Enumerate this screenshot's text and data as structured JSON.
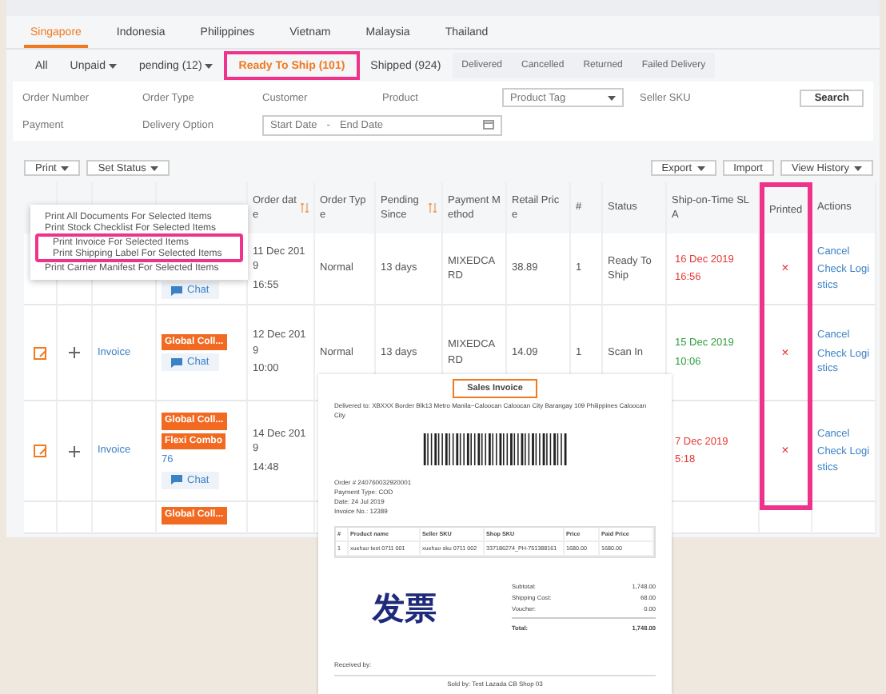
{
  "country_tabs": [
    {
      "label": "Singapore",
      "selected": true
    },
    {
      "label": "Indonesia",
      "selected": false
    },
    {
      "label": "Philippines",
      "selected": false
    },
    {
      "label": "Vietnam",
      "selected": false
    },
    {
      "label": "Malaysia",
      "selected": false
    },
    {
      "label": "Thailand",
      "selected": false
    }
  ],
  "status_tabs": [
    {
      "label": "All",
      "kind": "main",
      "dropdown": false,
      "selected": false,
      "highlighted": false
    },
    {
      "label": "Unpaid",
      "kind": "main",
      "dropdown": true,
      "selected": false,
      "highlighted": false
    },
    {
      "label": "pending (12)",
      "kind": "main",
      "dropdown": true,
      "selected": false,
      "highlighted": false
    },
    {
      "label": "Ready To Ship (101)",
      "kind": "main",
      "dropdown": false,
      "selected": true,
      "highlighted": true
    },
    {
      "label": "Shipped (924)",
      "kind": "main",
      "dropdown": false,
      "selected": false,
      "highlighted": false
    },
    {
      "label": "Delivered",
      "kind": "sub",
      "dropdown": false,
      "selected": false,
      "highlighted": false
    },
    {
      "label": "Cancelled",
      "kind": "sub",
      "dropdown": false,
      "selected": false,
      "highlighted": false
    },
    {
      "label": "Returned",
      "kind": "sub",
      "dropdown": false,
      "selected": false,
      "highlighted": false
    },
    {
      "label": "Failed Delivery",
      "kind": "sub",
      "dropdown": false,
      "selected": false,
      "highlighted": false
    }
  ],
  "filters": [
    [
      {
        "kind": "label",
        "text": "Order Number"
      },
      {
        "kind": "label",
        "text": "Order Type"
      },
      {
        "kind": "label",
        "text": "Customer"
      },
      {
        "kind": "label",
        "text": "Product"
      },
      {
        "kind": "select",
        "text": "Product Tag"
      },
      {
        "kind": "label",
        "text": "Seller SKU"
      },
      {
        "kind": "button",
        "text": "Search"
      }
    ],
    [
      {
        "kind": "label",
        "text": "Payment"
      },
      {
        "kind": "label",
        "text": "Delivery Option"
      },
      {
        "kind": "daterange",
        "start": "Start Date",
        "separator": "-",
        "end": "End Date"
      }
    ]
  ],
  "toolbar": {
    "left": [
      {
        "label": "Print",
        "dropdown": true
      },
      {
        "label": "Set Status",
        "dropdown": true
      }
    ],
    "right": [
      {
        "label": "Export",
        "dropdown": true
      },
      {
        "label": "Import",
        "dropdown": false
      },
      {
        "label": "View History",
        "dropdown": true
      }
    ]
  },
  "print_menu": [
    {
      "label": "Print All Documents For Selected Items",
      "highlighted": false
    },
    {
      "label": "Print Stock Checklist For Selected Items",
      "highlighted": false
    },
    {
      "label": "Print Invoice For Selected Items",
      "highlighted": true
    },
    {
      "label": "Print Shipping Label For Selected Items",
      "highlighted": true
    },
    {
      "label": "Print Carrier Manifest For Selected Items",
      "highlighted": false
    }
  ],
  "table": {
    "columns": [
      {
        "label": "Order date",
        "sortable": true,
        "highlighted": false
      },
      {
        "label": "Order Type",
        "sortable": false,
        "highlighted": false
      },
      {
        "label": "Pending Since",
        "sortable": true,
        "highlighted": false
      },
      {
        "label": "Payment Method",
        "sortable": false,
        "highlighted": false
      },
      {
        "label": "Retail Price",
        "sortable": false,
        "highlighted": false
      },
      {
        "label": "#",
        "sortable": false,
        "highlighted": false
      },
      {
        "label": "Status",
        "sortable": false,
        "highlighted": false
      },
      {
        "label": "Ship-on-Time SLA",
        "sortable": false,
        "highlighted": false
      },
      {
        "label": "Printed",
        "sortable": false,
        "highlighted": true
      },
      {
        "label": "Actions",
        "sortable": false,
        "highlighted": false
      }
    ],
    "rows": [
      {
        "tags": [],
        "chat": "Chat",
        "order_date": [
          "11 Dec 2019",
          "16:55"
        ],
        "order_type": "Normal",
        "pending": "13 days",
        "payment": "MIXEDCARD",
        "retail": "38.89",
        "qty": "1",
        "status": "Ready To Ship",
        "sla": [
          "16 Dec 2019",
          "16:56"
        ],
        "color": "#e53935",
        "printed": "×",
        "actions": [
          "Cancel",
          "Check Logistics"
        ]
      },
      {
        "link": "Invoice",
        "tags": [
          "Global Coll..."
        ],
        "chat": "Chat",
        "order_date": [
          "12 Dec 2019",
          "10:00"
        ],
        "order_type": "Normal",
        "pending": "13 days",
        "payment": "MIXEDCARD",
        "retail": "14.09",
        "qty": "1",
        "status": "Scan In",
        "sla": [
          "15 Dec 2019",
          "10:06"
        ],
        "color": "#2e9e3e",
        "printed": "×",
        "actions": [
          "Cancel",
          "Check Logistics"
        ]
      },
      {
        "link": "Invoice",
        "tags": [
          "Global Coll...",
          "Flexi Combo"
        ],
        "number": "76",
        "chat": "Chat",
        "order_date": [
          "14 Dec 2019",
          "14:48"
        ],
        "sla": [
          "7 Dec 2019",
          "5:18"
        ],
        "color": "#e53935",
        "printed": "×",
        "actions": [
          "Cancel",
          "Check Logistics"
        ]
      },
      {
        "tags": [
          "Global Coll..."
        ]
      }
    ]
  },
  "invoice": {
    "title": "Sales Invoice",
    "address": "Delivered to: XBXXX Border Blk13 Metro Manila~Caloocan Caloocan City Barangay 109 Philippines Caloocan City",
    "details": [
      "Order # 240760032920001",
      "Payment Type: COD",
      "Date: 24 Jul 2019",
      "Invoice No.: 12389"
    ],
    "columns": [
      "#",
      "Product name",
      "Seller SKU",
      "Shop SKU",
      "Price",
      "Paid Price"
    ],
    "rows": [
      [
        "1",
        "xuehao test 0711 001",
        "xuehao sku 0711 002",
        "337186274_PH-751388161",
        "1680.00",
        "1680.00"
      ]
    ],
    "totals": [
      {
        "label": "Subtotal:",
        "value": "1,748.00",
        "bold": false
      },
      {
        "label": "Shipping Cost:",
        "value": "68.00",
        "bold": false
      },
      {
        "label": "Voucher:",
        "value": "0.00",
        "bold": false
      },
      {
        "label": "Total:",
        "value": "1,748.00",
        "bold": true
      }
    ],
    "stamp": "发票",
    "received": "Received by:",
    "sold_by": "Sold by: Test Lazada CB Shop 03"
  }
}
